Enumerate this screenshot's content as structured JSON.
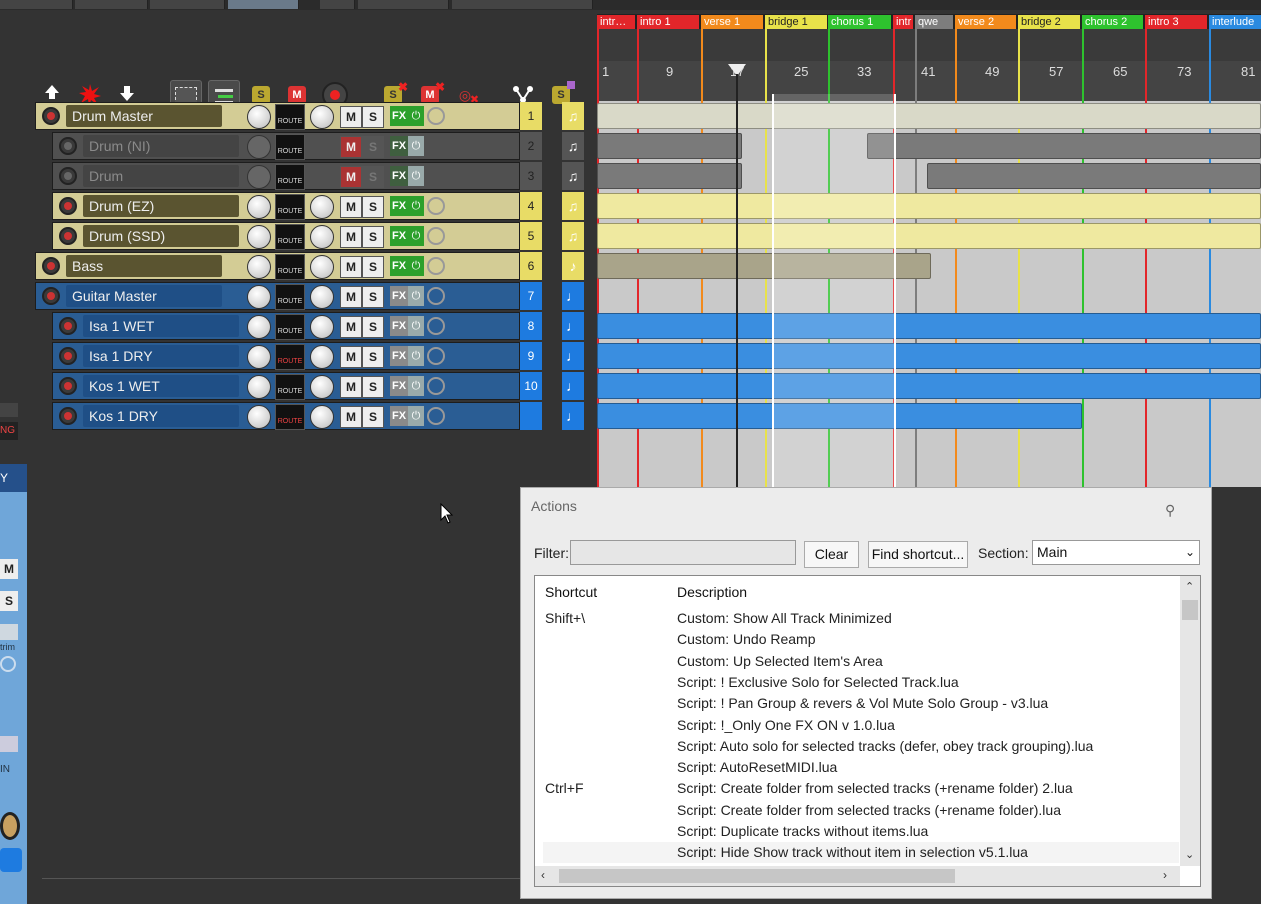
{
  "toolbar": {
    "buttons": [
      "upload-icon",
      "explode-icon",
      "download-icon",
      "select-area-icon",
      "tracks-icon",
      "solo-item-icon",
      "mute-item-icon",
      "record-icon",
      "unsolo-all-icon",
      "unmute-all-icon",
      "unarm-all-icon",
      "route-icon",
      "item-settings-icon"
    ]
  },
  "regions": [
    {
      "label": "intr…",
      "color": "#e2262a"
    },
    {
      "label": "intro 1",
      "color": "#e2262a"
    },
    {
      "label": "verse 1",
      "color": "#f28a1c"
    },
    {
      "label": "bridge 1",
      "color": "#e8e24a"
    },
    {
      "label": "chorus 1",
      "color": "#2ec22e"
    },
    {
      "label": "intr",
      "color": "#e2262a"
    },
    {
      "label": "qwe",
      "color": "#7d7d7d"
    },
    {
      "label": "verse 2",
      "color": "#f28a1c"
    },
    {
      "label": "bridge 2",
      "color": "#e8e24a"
    },
    {
      "label": "chorus 2",
      "color": "#2ec22e"
    },
    {
      "label": "intro 3",
      "color": "#e2262a"
    },
    {
      "label": "interlude",
      "color": "#2a8ae0"
    }
  ],
  "ruler": [
    "1",
    "9",
    "17",
    "25",
    "33",
    "41",
    "49",
    "57",
    "65",
    "73",
    "81"
  ],
  "tracks": [
    {
      "name": "Drum Master",
      "number": "1",
      "color": "#d4cf9a",
      "type": "folder"
    },
    {
      "name": "Drum (NI)",
      "number": "2",
      "color": "#5a5a5a",
      "type": "child"
    },
    {
      "name": "Drum",
      "number": "3",
      "color": "#5a5a5a",
      "type": "child"
    },
    {
      "name": "Drum (EZ)",
      "number": "4",
      "color": "#d4cf9a",
      "type": "child"
    },
    {
      "name": "Drum (SSD)",
      "number": "5",
      "color": "#d4cf9a",
      "type": "child"
    },
    {
      "name": "Bass",
      "number": "6",
      "color": "#d4cf9a",
      "type": "normal"
    },
    {
      "name": "Guitar Master",
      "number": "7",
      "color": "#5b9bd5",
      "type": "folder"
    },
    {
      "name": "Isa 1 WET",
      "number": "8",
      "color": "#5b9bd5",
      "type": "child"
    },
    {
      "name": "Isa 1 DRY",
      "number": "9",
      "color": "#5b9bd5",
      "type": "child"
    },
    {
      "name": "Kos 1 WET",
      "number": "10",
      "color": "#5b9bd5",
      "type": "child"
    },
    {
      "name": "Kos 1 DRY",
      "number": "",
      "color": "#5b9bd5",
      "type": "child"
    }
  ],
  "track_controls": {
    "route": "ROUTE",
    "mute": "M",
    "solo": "S",
    "fx": "FX"
  },
  "left_stub": {
    "labels": [
      "NG",
      "Y",
      "M",
      "S",
      "trim",
      "IN"
    ]
  },
  "actions": {
    "title": "Actions",
    "filter_label": "Filter:",
    "filter_value": "",
    "clear_label": "Clear",
    "find_shortcut_label": "Find shortcut...",
    "section_label": "Section:",
    "section_value": "Main",
    "col_shortcut": "Shortcut",
    "col_description": "Description",
    "rows": [
      {
        "shortcut": "Shift+\\",
        "description": "Custom: Show All Track Minimized"
      },
      {
        "shortcut": "",
        "description": "Custom: Undo Reamp"
      },
      {
        "shortcut": "",
        "description": "Custom: Up Selected Item's Area"
      },
      {
        "shortcut": "",
        "description": "Script: ! Exclusive Solo for Selected Track.lua"
      },
      {
        "shortcut": "",
        "description": "Script: ! Pan Group & revers & Vol Mute Solo Group - v3.lua"
      },
      {
        "shortcut": "",
        "description": "Script: !_Only One FX ON v 1.0.lua"
      },
      {
        "shortcut": "",
        "description": "Script: Auto solo for selected tracks (defer, obey track grouping).lua"
      },
      {
        "shortcut": "",
        "description": "Script: AutoResetMIDI.lua"
      },
      {
        "shortcut": "Ctrl+F",
        "description": "Script: Create folder from selected tracks (+rename folder) 2.lua"
      },
      {
        "shortcut": "",
        "description": "Script: Create folder from selected tracks (+rename folder).lua"
      },
      {
        "shortcut": "",
        "description": "Script: Duplicate tracks without items.lua"
      },
      {
        "shortcut": "",
        "description": "Script: Hide Show track without item in selection v5.1.lua"
      }
    ]
  }
}
